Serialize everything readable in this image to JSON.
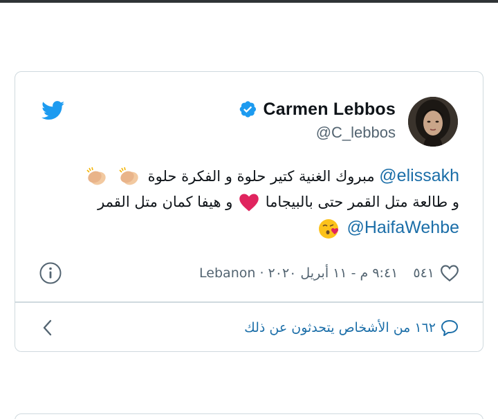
{
  "tweet": {
    "author": {
      "display_name": "Carmen Lebbos",
      "handle": "@C_lebbos",
      "verified": true
    },
    "lines": [
      {
        "mention": "@elissakh",
        "text": "مبروك الغنية كتير حلوة و الفكرة حلوة",
        "trailing_emoji": [
          "clapping-hands",
          "clapping-hands"
        ]
      },
      {
        "text_before": "و طالعة متل القمر حتى بالبيجاما",
        "inline_emoji": "red-heart",
        "text_after": "و هيفا كمان متل القمر"
      },
      {
        "mention": "@HaifaWehbe",
        "trailing_emoji": [
          "face-blowing-kiss"
        ]
      }
    ],
    "likes": "٥٤١",
    "timestamp": "٩:٤١ م - ١١ أبريل ٢٠٢٠ · Lebanon",
    "replies_text": "١٦٢ من الأشخاص يتحدثون عن ذلك"
  },
  "colors": {
    "twitter_blue": "#1d9bf0",
    "link_blue": "#1b6ea8",
    "heart_red": "#e0245e",
    "muted_gray": "#536471",
    "border": "#cfd9de"
  },
  "icons": [
    "twitter-bird-icon",
    "verified-badge-icon",
    "info-icon",
    "heart-outline-icon",
    "speech-bubble-icon",
    "chevron-left-icon"
  ]
}
